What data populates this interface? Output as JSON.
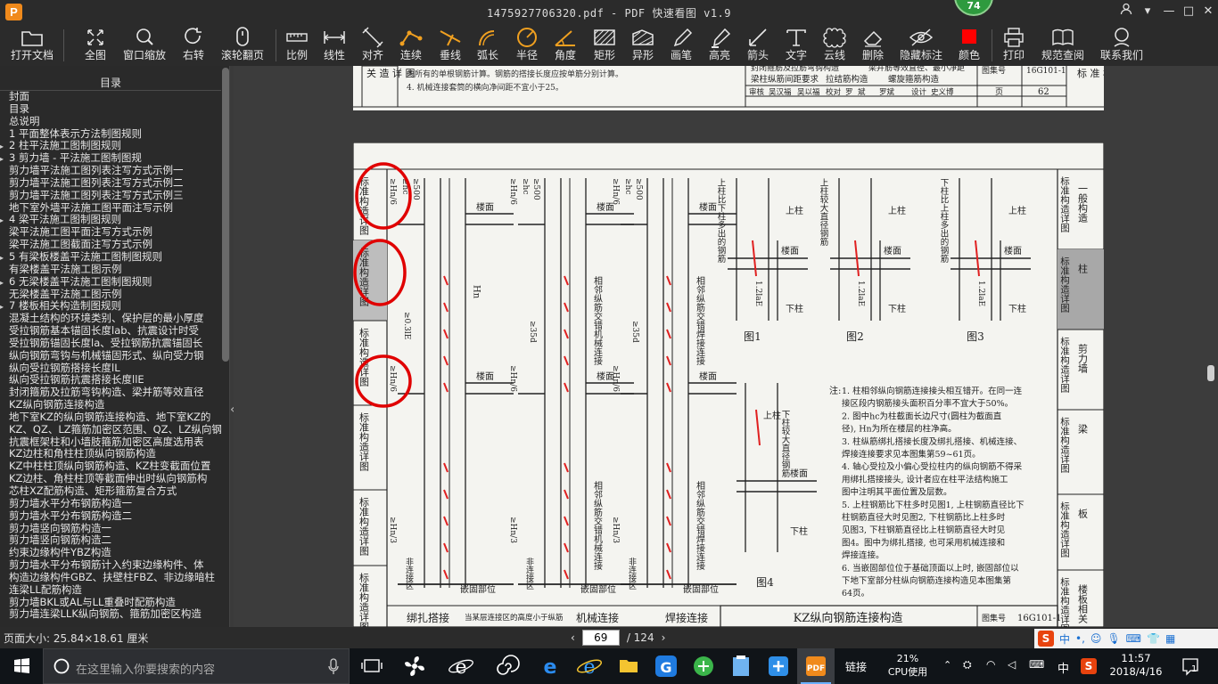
{
  "window": {
    "title": "1475927706320.pdf - PDF 快速看图 v1.9",
    "badge": "74",
    "controls": [
      "⇩",
      "▾",
      "—",
      "□",
      "✕"
    ]
  },
  "toolbar": [
    {
      "label": "打开文档",
      "icon": "folder-icon"
    },
    {
      "label": "全图",
      "icon": "fit-page-icon"
    },
    {
      "label": "窗口缩放",
      "icon": "zoom-icon"
    },
    {
      "label": "右转",
      "icon": "rotate-right-icon"
    },
    {
      "label": "滚轮翻页",
      "icon": "mouse-icon"
    },
    {
      "label": "比例",
      "icon": "scale-icon"
    },
    {
      "label": "线性",
      "icon": "linear-dim-icon"
    },
    {
      "label": "对齐",
      "icon": "aligned-dim-icon"
    },
    {
      "label": "连续",
      "icon": "continuous-dim-icon"
    },
    {
      "label": "垂线",
      "icon": "perpendicular-icon"
    },
    {
      "label": "弧长",
      "icon": "arc-length-icon"
    },
    {
      "label": "半径",
      "icon": "radius-icon"
    },
    {
      "label": "角度",
      "icon": "angle-icon"
    },
    {
      "label": "矩形",
      "icon": "rectangle-icon"
    },
    {
      "label": "异形",
      "icon": "polygon-icon"
    },
    {
      "label": "画笔",
      "icon": "pen-icon"
    },
    {
      "label": "高亮",
      "icon": "highlighter-icon"
    },
    {
      "label": "箭头",
      "icon": "arrow-icon"
    },
    {
      "label": "文字",
      "icon": "text-icon"
    },
    {
      "label": "云线",
      "icon": "cloud-icon"
    },
    {
      "label": "删除",
      "icon": "eraser-icon"
    },
    {
      "label": "隐藏标注",
      "icon": "hide-eye-icon"
    },
    {
      "label": "颜色",
      "icon": "color-swatch-icon",
      "color": "#ff0000"
    },
    {
      "label": "打印",
      "icon": "printer-icon"
    },
    {
      "label": "规范查阅",
      "icon": "book-search-icon"
    },
    {
      "label": "联系我们",
      "icon": "contact-icon"
    }
  ],
  "sidebar": {
    "title": "目录",
    "items": [
      {
        "text": "封面",
        "arrow": ""
      },
      {
        "text": "目录",
        "arrow": ""
      },
      {
        "text": "总说明",
        "arrow": ""
      },
      {
        "text": "1 平面整体表示方法制图规则",
        "arrow": ""
      },
      {
        "text": "2 柱平法施工图制图规则",
        "arrow": "▸"
      },
      {
        "text": "3 剪力墙 - 平法施工图制图规",
        "arrow": "▸"
      },
      {
        "text": "剪力墙平法施工图列表注写方式示例一",
        "arrow": ""
      },
      {
        "text": "剪力墙平法施工图列表注写方式示例二",
        "arrow": ""
      },
      {
        "text": "剪力墙平法施工图列表注写方式示例三",
        "arrow": ""
      },
      {
        "text": "地下室外墙平法施工图平面注写示例",
        "arrow": ""
      },
      {
        "text": "4 梁平法施工图制图规则",
        "arrow": "▸"
      },
      {
        "text": "梁平法施工图平面注写方式示例",
        "arrow": ""
      },
      {
        "text": "梁平法施工图截面注写方式示例",
        "arrow": ""
      },
      {
        "text": "5 有梁板楼盖平法施工图制图规则",
        "arrow": "▸"
      },
      {
        "text": "有梁楼盖平法施工图示例",
        "arrow": ""
      },
      {
        "text": "6 无梁楼盖平法施工图制图规则",
        "arrow": "▸"
      },
      {
        "text": "无梁楼盖平法施工图示例",
        "arrow": ""
      },
      {
        "text": "7 楼板相关构造制图规则",
        "arrow": "▸"
      },
      {
        "text": "混凝土结构的环境类别、保护层的最小厚度",
        "arrow": ""
      },
      {
        "text": "受拉钢筋基本锚固长度lab、抗震设计时受",
        "arrow": ""
      },
      {
        "text": "受拉钢筋锚固长度la、受拉钢筋抗震锚固长",
        "arrow": ""
      },
      {
        "text": "纵向钢筋弯钩与机械锚固形式、纵向受力钢",
        "arrow": ""
      },
      {
        "text": "纵向受拉钢筋搭接长度lL",
        "arrow": ""
      },
      {
        "text": "纵向受拉钢筋抗震搭接长度llE",
        "arrow": ""
      },
      {
        "text": "封闭箍筋及拉筋弯钩构造、梁并筋等效直径",
        "arrow": ""
      },
      {
        "text": "KZ纵向钢筋连接构造",
        "arrow": ""
      },
      {
        "text": "地下室KZ的纵向钢筋连接构造、地下室KZ的",
        "arrow": ""
      },
      {
        "text": "KZ、QZ、LZ箍筋加密区范围、QZ、LZ纵向钢",
        "arrow": ""
      },
      {
        "text": "抗震框架柱和小墙肢箍筋加密区高度选用表",
        "arrow": ""
      },
      {
        "text": "KZ边柱和角柱柱顶纵向钢筋构造",
        "arrow": ""
      },
      {
        "text": "KZ中柱柱顶纵向钢筋构造、KZ柱变截面位置",
        "arrow": ""
      },
      {
        "text": "KZ边柱、角柱柱顶等截面伸出时纵向钢筋构",
        "arrow": ""
      },
      {
        "text": "芯柱XZ配筋构造、矩形箍筋复合方式",
        "arrow": ""
      },
      {
        "text": "剪力墙水平分布钢筋构造一",
        "arrow": ""
      },
      {
        "text": "剪力墙水平分布钢筋构造二",
        "arrow": ""
      },
      {
        "text": "剪力墙竖向钢筋构造一",
        "arrow": ""
      },
      {
        "text": "剪力墙竖向钢筋构造二",
        "arrow": ""
      },
      {
        "text": "约束边缘构件YBZ构造",
        "arrow": ""
      },
      {
        "text": "剪力墙水平分布钢筋计入约束边缘构件、体",
        "arrow": ""
      },
      {
        "text": "构造边缘构件GBZ、扶壁柱FBZ、非边缘暗柱",
        "arrow": ""
      },
      {
        "text": "连梁LL配筋构造",
        "arrow": ""
      },
      {
        "text": "剪力墙BKL或AL与LL重叠时配筋构造",
        "arrow": ""
      },
      {
        "text": "剪力墙连梁LLK纵向钢筋、箍筋加密区构造",
        "arrow": ""
      }
    ]
  },
  "document": {
    "top_fragment": {
      "note_lines": [
        "内所有的单根钢筋计算。钢筋的搭接长度应按单筋分别计算。",
        "4. 机械连接套筒的横向净间距不宜小于25。"
      ],
      "left_label": "关 造 详 图",
      "title_block": [
        "封闭箍筋及拉筋弯钩构造",
        "梁并筋等效直径、最小净距",
        "梁柱纵筋间距要求",
        "拉结筋构造",
        "螺旋箍筋构造"
      ],
      "atlas_no_label": "图集号",
      "atlas_no": "16G101-1",
      "page_label": "页",
      "page_no": "62",
      "review_row": [
        "审核",
        "吴汉福",
        "吴以福",
        "校对",
        "罗",
        "斌",
        "罗斌",
        "设计",
        "史义博"
      ],
      "right_label": "标 准 构 造 详 图"
    },
    "main": {
      "side_labels": [
        "标准构造详图",
        "标准构造详图",
        "标准构造详图",
        "标准构造详图",
        "标准构造详图",
        "标准构造详图"
      ],
      "right_tabs": [
        {
          "label": "一般构造",
          "prefix": "标准构造详图",
          "active": false
        },
        {
          "label": "柱",
          "prefix": "标准构造详图",
          "active": true
        },
        {
          "label": "剪力墙",
          "prefix": "标准构造详图",
          "active": false
        },
        {
          "label": "梁",
          "prefix": "标准构造详图",
          "active": false
        },
        {
          "label": "板",
          "prefix": "标准构造详图",
          "active": false
        },
        {
          "label": "楼板相关",
          "prefix": "标准构造详图",
          "active": false
        }
      ],
      "labels": {
        "floor": "楼面",
        "upper_col": "上柱",
        "lower_col": "下柱",
        "dim_hn6": "≥Hn/6",
        "dim_hc": "≥hc",
        "dim_500": "≥500",
        "dim_hn3": "≥Hn/3",
        "dim_035": "≥0.3lE",
        "dim_lle": "llE",
        "dim_35d": "≥35d",
        "hn": "Hn",
        "non_conn": "非连接区",
        "embed": "嵌固部位",
        "adj_mech": "相邻纵筋交错机械连接",
        "adj_weld": "相邻纵筋交错焊接连接",
        "fig1_note": "上柱比下柱多出的钢筋",
        "fig3_note": "下柱比上柱多出的钢筋",
        "fig2_note": "上柱较大直径钢筋",
        "fig4_note": "下柱较大直径钢筋",
        "dim_12lae": "1.2laE"
      },
      "fig_titles": [
        "图1",
        "图2",
        "图3",
        "图4"
      ],
      "bottom_captions": [
        "绑扎搭接",
        "当某层连接区的高度小于纵筋",
        "机械连接",
        "焊接连接"
      ],
      "note_title": "注:",
      "notes": [
        "1. 柱相邻纵向钢筋连接接头相互错开。在同一连",
        "接区段内钢筋接头面积百分率不宜大于50%。",
        "2. 图中hc为柱截面长边尺寸(圆柱为截面直",
        "径), Hn为所在楼层的柱净高。",
        "3. 柱纵筋绑扎搭接长度及绑扎搭接、机械连接、",
        "焊接连接要求见本图集第59~61页。",
        "4. 轴心受拉及小偏心受拉柱内的纵向钢筋不得采",
        "用绑扎搭接接头, 设计者应在柱平法结构施工",
        "图中注明其平面位置及层数。",
        "5. 上柱钢筋比下柱多时见图1, 上柱钢筋直径比下",
        "柱钢筋直径大时见图2, 下柱钢筋比上柱多时",
        "见图3, 下柱钢筋直径比上柱钢筋直径大时见",
        "图4。图中为绑扎搭接, 也可采用机械连接和",
        "焊接连接。",
        "6. 当嵌固部位位于基础顶面以上时, 嵌固部位以",
        "下地下室部分柱纵向钢筋连接构造见本图集第",
        "64页。"
      ],
      "footer_title": "KZ纵向钢筋连接构造",
      "footer_atlas_label": "图集号",
      "footer_atlas": "16G101-1"
    }
  },
  "status": {
    "page_size": "页面大小: 25.84×18.61 厘米",
    "current_page": "69",
    "total_pages": "/ 124",
    "prev": "‹",
    "next": "›",
    "ime_label": "中"
  },
  "taskbar": {
    "search_placeholder": "在这里输入你要搜索的内容",
    "link_label": "链接",
    "cpu_percent": "21%",
    "cpu_label": "CPU使用",
    "lang": "中",
    "time": "11:57",
    "date": "2018/4/16",
    "notification_count": "1"
  }
}
